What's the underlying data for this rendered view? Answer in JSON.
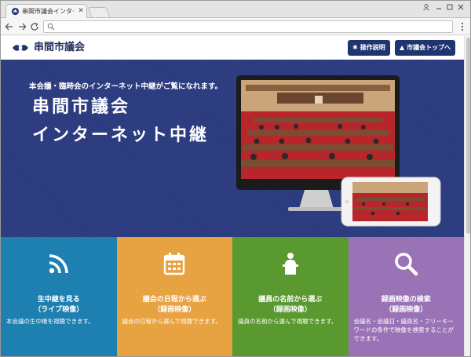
{
  "browser": {
    "tab_title": "串間市議会インターネット中",
    "tab_close": "✕",
    "new_tab": "",
    "url": ""
  },
  "site": {
    "title": "串間市議会",
    "buttons": {
      "manual": "操作説明",
      "top": "市議会トップへ"
    }
  },
  "hero": {
    "subtitle": "本会議・臨時会のインターネット中継がご覧になれます。",
    "title_line1": "串間市議会",
    "title_line2": "インターネット中継"
  },
  "tiles": [
    {
      "title_line1": "生中継を見る",
      "title_line2": "（ライブ映像）",
      "desc": "本会議の生中継を視聴できます。",
      "icon": "live-broadcast-icon",
      "color": "#1e7fb1"
    },
    {
      "title_line1": "議会の日程から選ぶ",
      "title_line2": "（録画映像）",
      "desc": "議会の日程から選んで視聴できます。",
      "icon": "calendar-icon",
      "color": "#e7a241"
    },
    {
      "title_line1": "議員の名前から選ぶ",
      "title_line2": "（録画映像）",
      "desc": "議員の名前から選んで視聴できます。",
      "icon": "speaker-podium-icon",
      "color": "#5a9830"
    },
    {
      "title_line1": "録画映像の検索",
      "title_line2": "（録画映像）",
      "desc": "会議名・会議日・議員名・フリーキーワードの条件で映像を検索することができます。",
      "icon": "search-icon",
      "color": "#9a73b6"
    }
  ],
  "colors": {
    "hero_bg": "#2a3a7e",
    "header_btn": "#1f3470",
    "brand_text": "#1f2d5a"
  }
}
